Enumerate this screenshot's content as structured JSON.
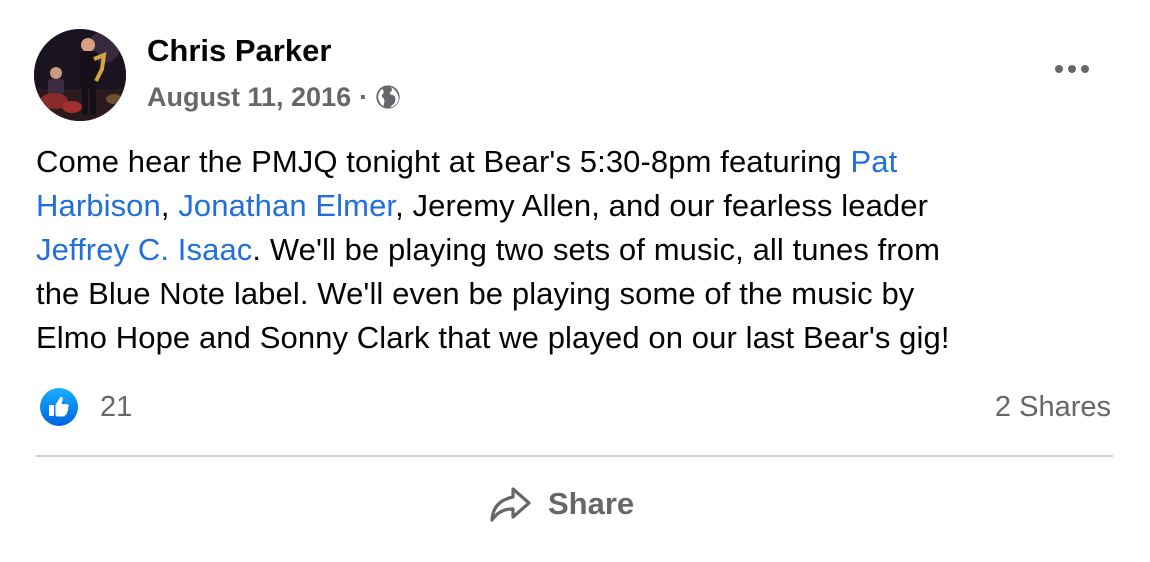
{
  "post": {
    "author": "Chris Parker",
    "date": "August 11, 2016",
    "separator": "·",
    "audience_icon": "globe-icon",
    "more_icon": "more-options-icon",
    "text_lines": [
      [
        {
          "text": "Come hear the PMJQ tonight at Bear's 5:30-8pm featuring ",
          "mention": false
        },
        {
          "text": "Pat",
          "mention": true
        }
      ],
      [
        {
          "text": "Harbison",
          "mention": true
        },
        {
          "text": ", ",
          "mention": false
        },
        {
          "text": "Jonathan Elmer",
          "mention": true
        },
        {
          "text": ", Jeremy Allen, and our fearless leader",
          "mention": false
        }
      ],
      [
        {
          "text": "Jeffrey C. Isaac",
          "mention": true
        },
        {
          "text": ". We'll be playing two sets of music, all tunes from",
          "mention": false
        }
      ],
      [
        {
          "text": "the Blue Note label. We'll even be playing some of the music by",
          "mention": false
        }
      ],
      [
        {
          "text": "Elmo Hope and Sonny Clark that we played on our last Bear's gig!",
          "mention": false
        }
      ]
    ]
  },
  "reactions": {
    "icon": "like-icon",
    "count": "21",
    "shares": "2 Shares"
  },
  "actions": {
    "share_label": "Share",
    "share_icon": "share-arrow-icon"
  },
  "colors": {
    "mention": "#216fdb",
    "secondary_text": "#65676b",
    "like_blue": "#1877f2",
    "divider": "#ced0d4"
  }
}
